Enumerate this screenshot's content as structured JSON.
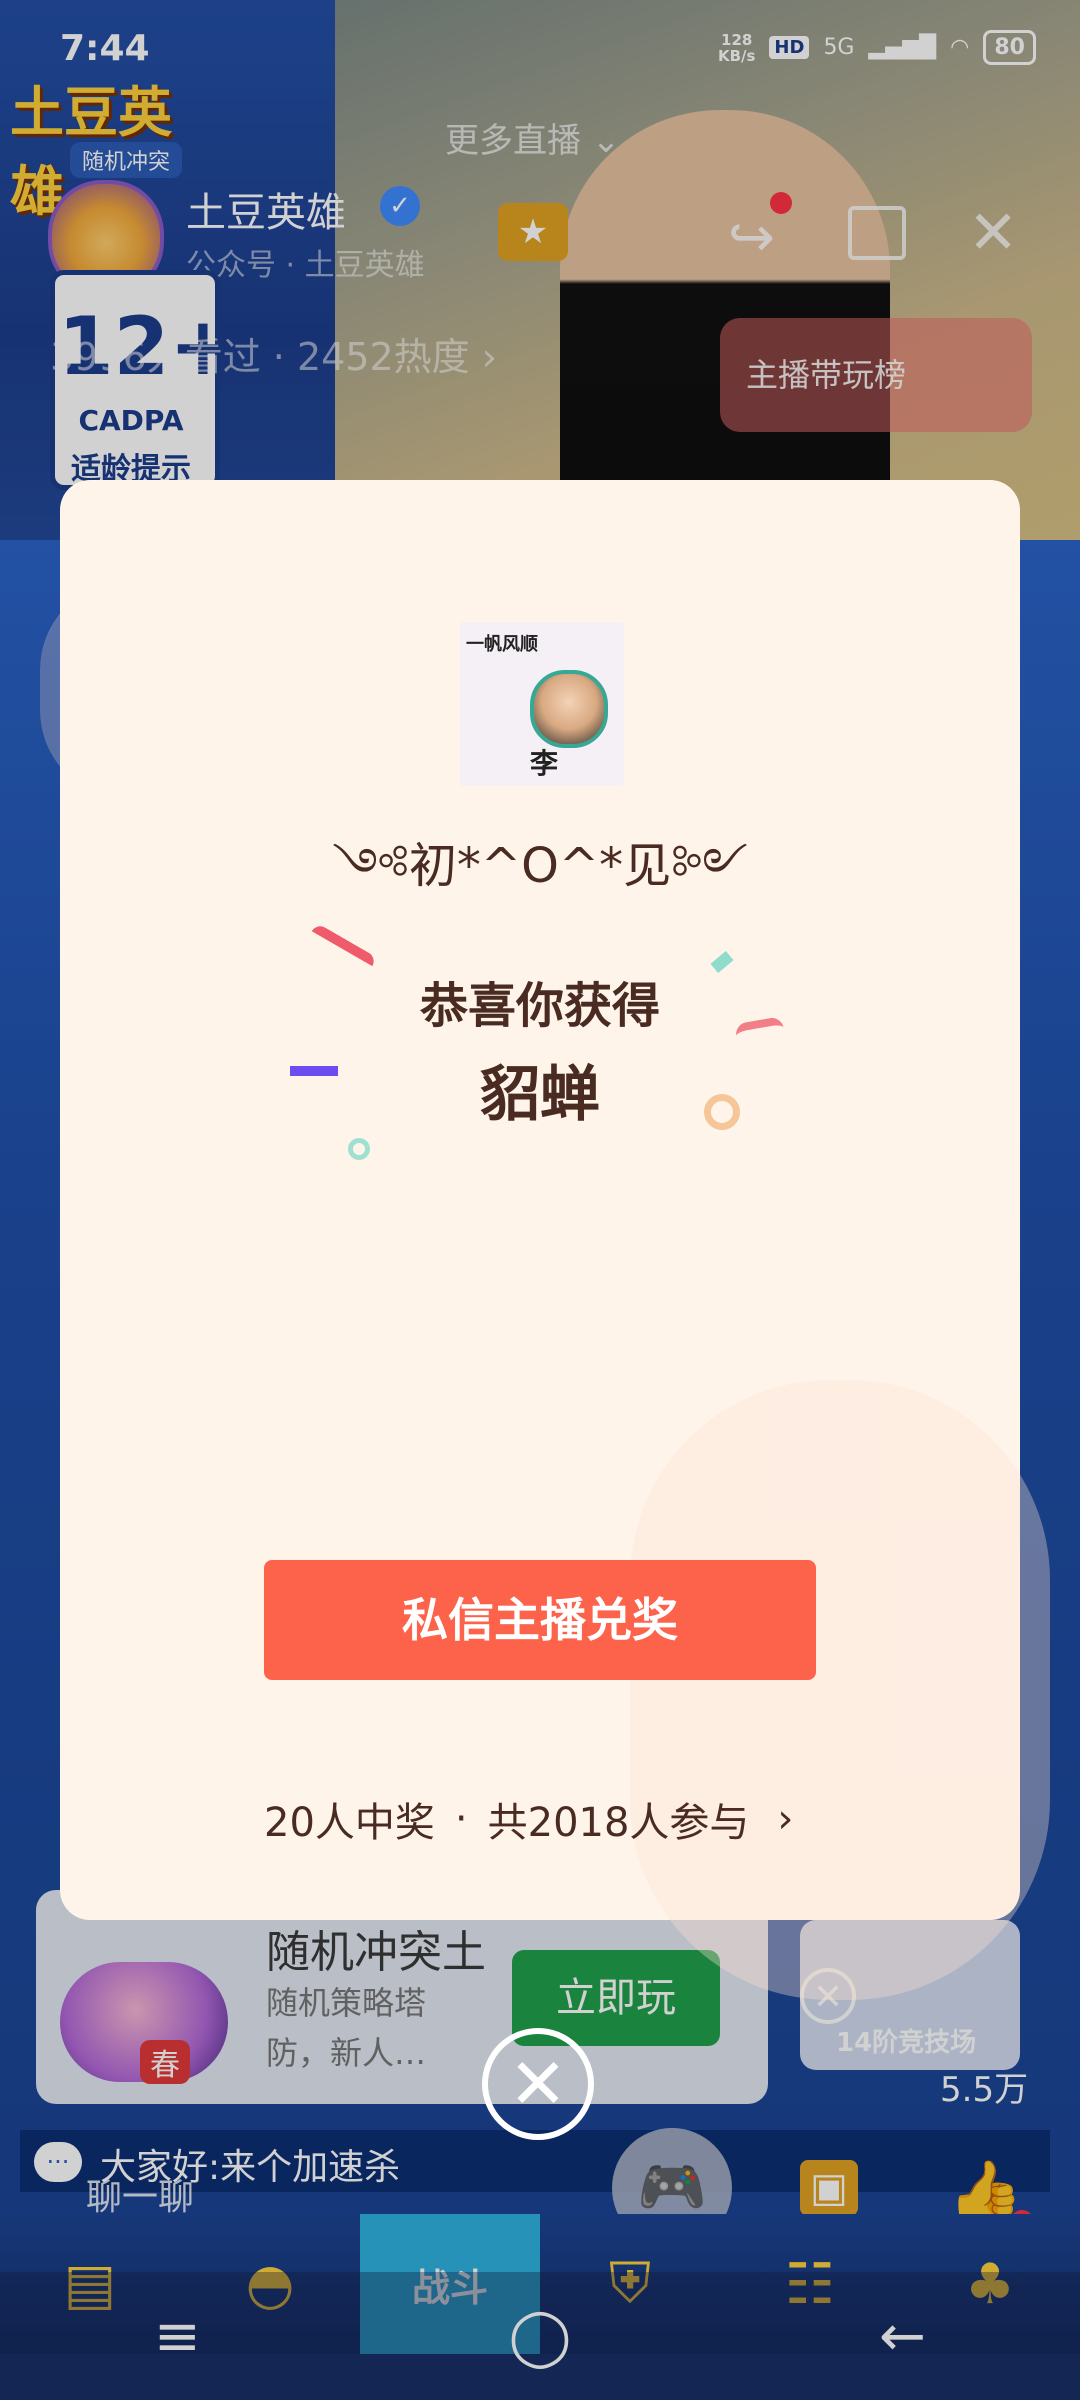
{
  "status_bar": {
    "time": "7:44",
    "net_speed": "128\nKB/s",
    "hd": "HD",
    "network": "5G",
    "battery": "80"
  },
  "header": {
    "game_logo": "土豆英雄",
    "game_logo_sub": "随机冲突",
    "more_live": "更多直播 ⌄",
    "streamer_name": "土豆英雄",
    "verified_icon": "verified-check-icon",
    "account_type": "公众号 · 土豆英雄",
    "stats": "3996人看过 · 2452热度 ›",
    "rating_badge": {
      "age": "12+",
      "org": "CADPA",
      "tip": "适龄提示"
    },
    "rank_pill": "主播带玩榜"
  },
  "modal": {
    "winner_avatar_text": "一帆风顺",
    "winner_avatar_sign": "李",
    "winner_name": "༺初*^O^*见༻",
    "congrats": "恭喜你获得",
    "prize": "貂蝉",
    "claim_button": "私信主播兑奖",
    "winners_count": "20人中奖",
    "participants": "共2018人参与",
    "separator": "·"
  },
  "promo": {
    "title": "随机冲突土",
    "desc": "随机策略塔防，新人…",
    "stamp": "春",
    "play_button": "立即玩",
    "pk_label": "14阶竞技场",
    "pk_count": "5.5万"
  },
  "chat": {
    "message": "大家好:来个加速杀",
    "hint": "聊一聊"
  },
  "tabs": [
    {
      "label": "",
      "icon": "chest-icon"
    },
    {
      "label": "",
      "icon": "helmet-icon"
    },
    {
      "label": "战斗",
      "icon": "sword-icon"
    },
    {
      "label": "",
      "icon": "shield-icon"
    },
    {
      "label": "",
      "icon": "team-icon"
    },
    {
      "label": "",
      "icon": "sprout-icon"
    }
  ],
  "nav": {
    "menu": "≡",
    "home": "◯",
    "back": "←"
  }
}
